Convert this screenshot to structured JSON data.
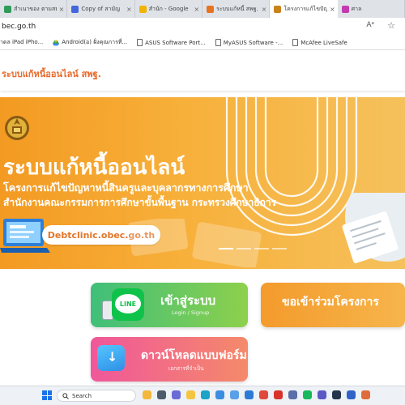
{
  "tabs": [
    {
      "title": "สำเนาของ ตามสมาชิก",
      "favicon_color": "#2f9c5a",
      "active": false
    },
    {
      "title": "Copy of สามัญ",
      "favicon_color": "#4466dd",
      "active": false
    },
    {
      "title": "สำนัก - Google",
      "favicon_color": "#f0b400",
      "active": false
    },
    {
      "title": "ระบบแก้หนี้ สพฐ. - ...",
      "favicon_color": "#e8731e",
      "active": false
    },
    {
      "title": "โครงการแก้ไขปัญหา",
      "favicon_color": "#c9831a",
      "active": true
    },
    {
      "title": "ศาล",
      "favicon_color": "#c43ab0",
      "active": false
    }
  ],
  "address_bar": {
    "url": "bec.go.th",
    "reader_label": "Aᵃ",
    "star": "☆"
  },
  "bookmarks": [
    {
      "label": "าดล iPad iPho...",
      "icon": "none"
    },
    {
      "label": "Android(อ) ฝั่งคุณการที่...",
      "icon": "google-drive-icon"
    },
    {
      "label": "ASUS Software Port...",
      "icon": "doc-icon"
    },
    {
      "label": "MyASUS Software -...",
      "icon": "doc-icon"
    },
    {
      "label": "McAfee LiveSafe",
      "icon": "doc-icon"
    }
  ],
  "site": {
    "title": "ระบบแก้หนี้ออนไลน์ สพฐ."
  },
  "hero": {
    "title": "ระบบแก้หนี้ออนไลน์",
    "subtitle1": "โครงการแก้ไขปัญหาหนี้สินครูและบุคลากรทางการศึกษา",
    "subtitle2": "สำนักงานคณะกรรมการการศึกษาขั้นพื้นฐาน กระทรวงศึกษาธิการ",
    "website": "Debtclinic.obec.go.th",
    "slides": 4,
    "active_slide": 0
  },
  "actions": {
    "login": {
      "label": "เข้าสู่ระบบ",
      "sub": "Login / Signup",
      "logo_text": "LINE"
    },
    "join": {
      "label": "ขอเข้าร่วมโครงการ"
    },
    "download": {
      "label": "ดาวน์โหลดแบบฟอร์ม",
      "sub": "เอกสารที่จำเป็น"
    }
  },
  "taskbar": {
    "search_placeholder": "Search"
  },
  "colors": {
    "accent": "#e86a2c",
    "hero": "#f5a52c",
    "line": "#0fc24a"
  }
}
